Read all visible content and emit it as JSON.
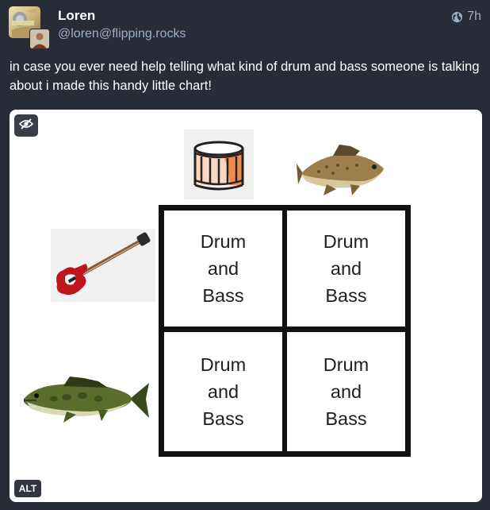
{
  "author": {
    "display_name": "Loren",
    "handle": "@loren@flipping.rocks",
    "avatar_icon": "avatar-image"
  },
  "meta": {
    "visibility_icon": "globe-icon",
    "timestamp": "7h"
  },
  "status": {
    "text": "in case you ever need help telling what kind of drum and bass someone is talking about i made this handy little chart!"
  },
  "media": {
    "alt_label": "ALT",
    "hide_icon": "eye-slash-icon",
    "images": {
      "column_1": "snare-drum-icon",
      "column_2": "drum-fish-icon",
      "row_1": "bass-guitar-icon",
      "row_2": "bass-fish-icon"
    },
    "grid": [
      {
        "line1": "Drum",
        "line2": "and",
        "line3": "Bass"
      },
      {
        "line1": "Drum",
        "line2": "and",
        "line3": "Bass"
      },
      {
        "line1": "Drum",
        "line2": "and",
        "line3": "Bass"
      },
      {
        "line1": "Drum",
        "line2": "and",
        "line3": "Bass"
      }
    ]
  },
  "colors": {
    "background": "#282c37",
    "secondary_text": "#9baec8",
    "card": "#ffffff",
    "grid_line": "#111111"
  }
}
